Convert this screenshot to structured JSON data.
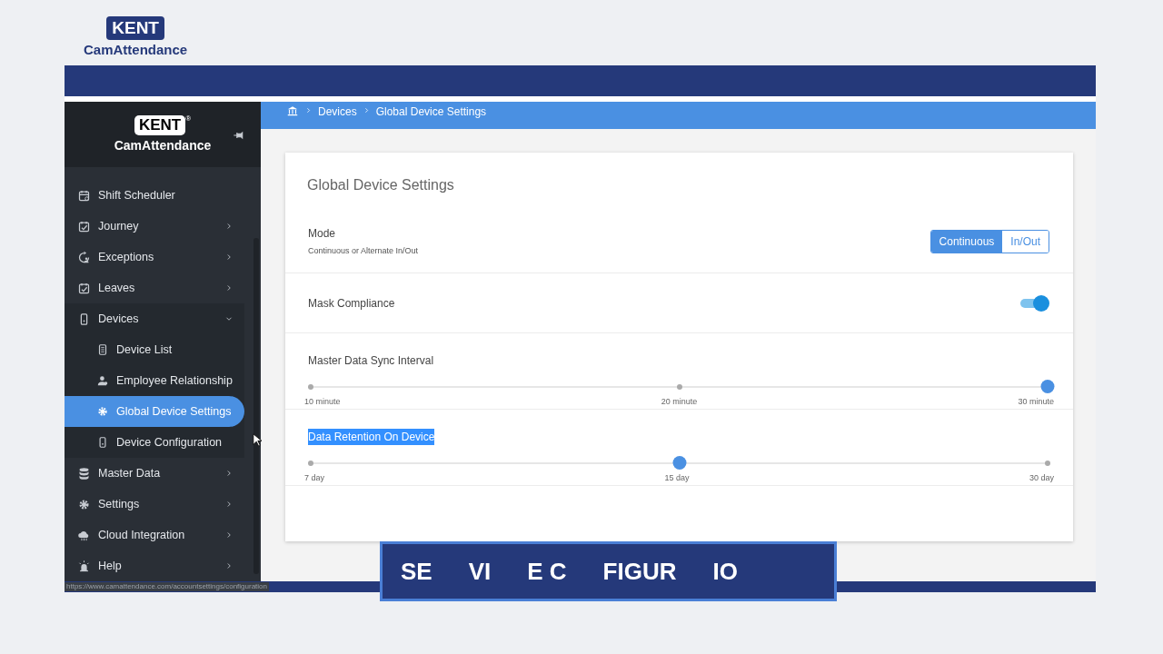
{
  "brand": {
    "badge": "KENT",
    "name": "CamAttendance"
  },
  "app": {
    "logo": {
      "badge": "KENT",
      "mark": "®",
      "name": "CamAttendance"
    },
    "sidebar": {
      "items": [
        {
          "label": "Shift Scheduler",
          "expandable": false,
          "selected": false
        },
        {
          "label": "Journey",
          "expandable": true,
          "selected": false
        },
        {
          "label": "Exceptions",
          "expandable": true,
          "selected": false
        },
        {
          "label": "Leaves",
          "expandable": true,
          "selected": false
        },
        {
          "label": "Devices",
          "expandable": true,
          "expanded": true,
          "selected": false,
          "children": [
            {
              "label": "Device List",
              "selected": false
            },
            {
              "label": "Employee Relationship",
              "selected": false
            },
            {
              "label": "Global Device Settings",
              "selected": true
            },
            {
              "label": "Device Configuration",
              "selected": false
            }
          ]
        },
        {
          "label": "Master Data",
          "expandable": true,
          "selected": false
        },
        {
          "label": "Settings",
          "expandable": true,
          "selected": false
        },
        {
          "label": "Cloud Integration",
          "expandable": true,
          "selected": false
        },
        {
          "label": "Help",
          "expandable": true,
          "selected": false
        }
      ]
    },
    "status_url": "https://www.camattendance.com/accountsettings/configuration",
    "breadcrumb": [
      "Devices",
      "Global Device Settings"
    ],
    "card": {
      "title": "Global Device Settings",
      "settings": [
        {
          "kind": "segmented",
          "label": "Mode",
          "hint": "Continuous or Alternate In/Out",
          "options": [
            {
              "label": "Continuous",
              "selected": true
            },
            {
              "label": "In/Out",
              "selected": false
            }
          ]
        },
        {
          "kind": "toggle",
          "label": "Mask Compliance",
          "on": true
        },
        {
          "kind": "slider",
          "label": "Master Data Sync Interval",
          "highlighted": false,
          "level": 1,
          "stops": [
            "10 minute",
            "20 minute",
            "30 minute"
          ]
        },
        {
          "kind": "slider",
          "label": "Data Retention On Device",
          "highlighted": true,
          "level": 0.5,
          "stops": [
            "7 day",
            "15 day",
            "30 day"
          ]
        }
      ]
    }
  },
  "caption": [
    "SE",
    "VI",
    "E C",
    "FIGUR",
    "IO"
  ]
}
